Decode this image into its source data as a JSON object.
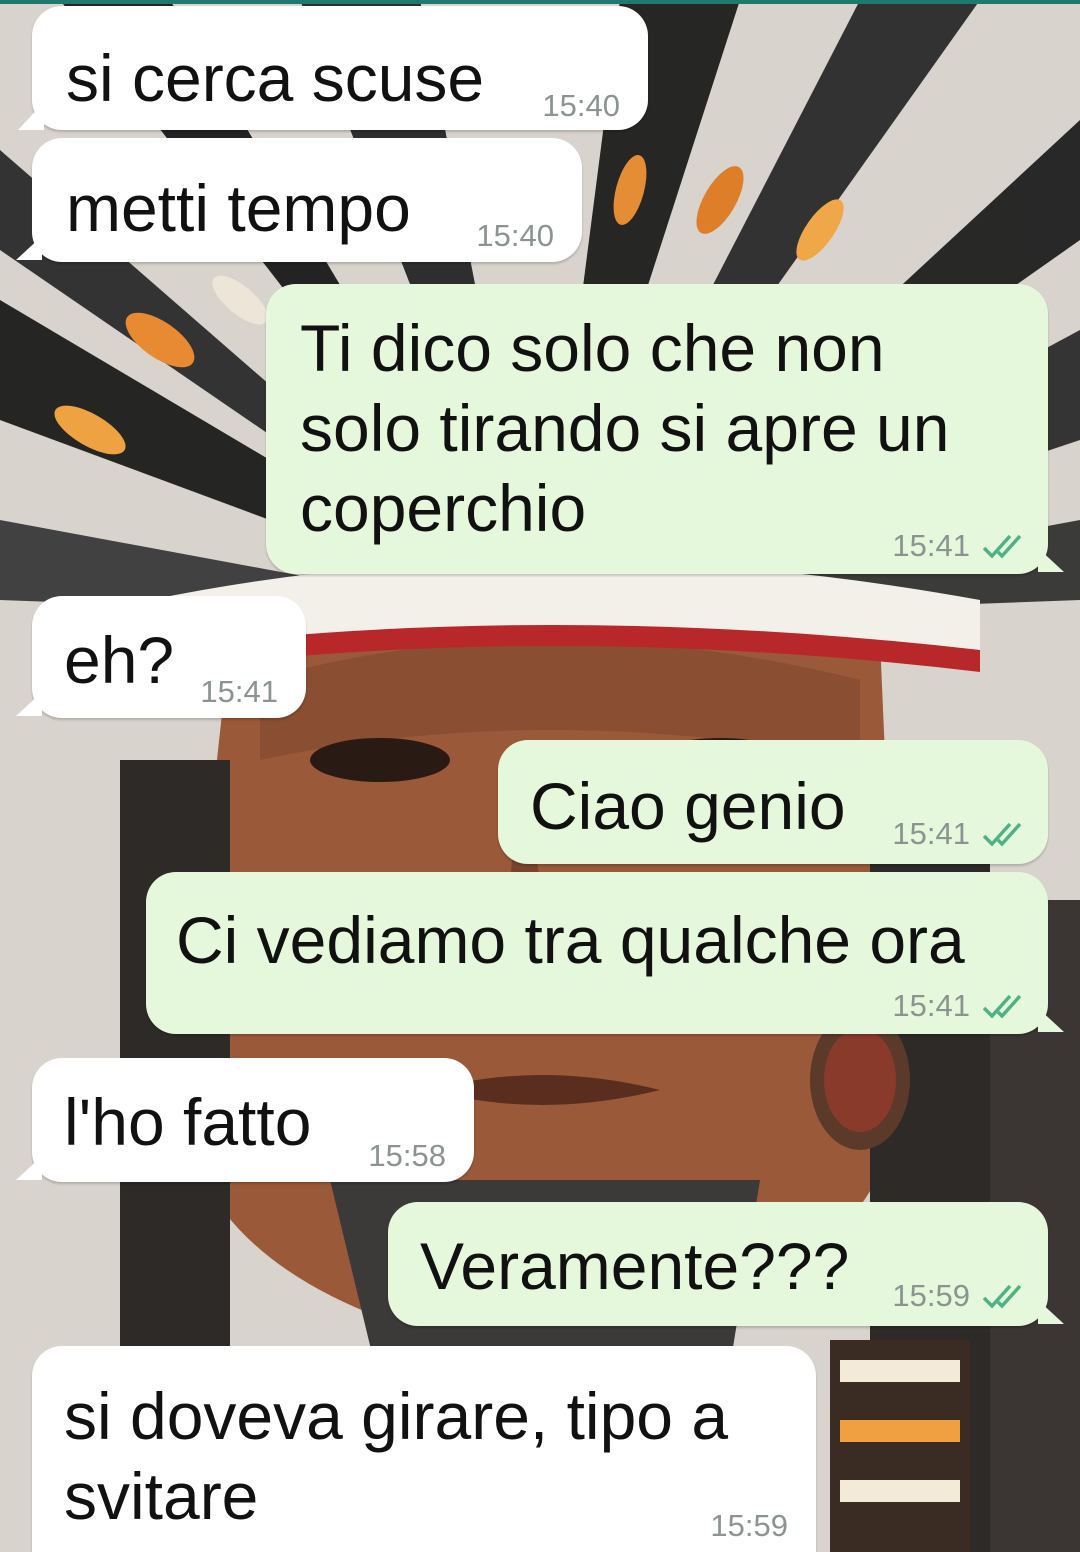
{
  "theme": {
    "incoming_bg": "#ffffff",
    "outgoing_bg": "#e6f8dc",
    "tick_color": "#4fb286"
  },
  "wallpaper": {
    "description_icon": "feather-headdress-portrait"
  },
  "messages": [
    {
      "direction": "incoming",
      "text": "si cerca scuse",
      "time": "15:40"
    },
    {
      "direction": "incoming",
      "text": "metti tempo",
      "time": "15:40"
    },
    {
      "direction": "outgoing",
      "text": "Ti dico solo che non\nsolo tirando si apre un\ncoperchio",
      "time": "15:41",
      "status": "read"
    },
    {
      "direction": "incoming",
      "text": "eh?",
      "time": "15:41"
    },
    {
      "direction": "outgoing",
      "text": "Ciao genio",
      "time": "15:41",
      "status": "read"
    },
    {
      "direction": "outgoing",
      "text": "Ci vediamo tra qualche ora",
      "time": "15:41",
      "status": "read"
    },
    {
      "direction": "incoming",
      "text": "l'ho fatto",
      "time": "15:58"
    },
    {
      "direction": "outgoing",
      "text": "Veramente???",
      "time": "15:59",
      "status": "read"
    },
    {
      "direction": "incoming",
      "text": "si doveva girare, tipo a\nsvitare",
      "time": "15:59"
    }
  ]
}
